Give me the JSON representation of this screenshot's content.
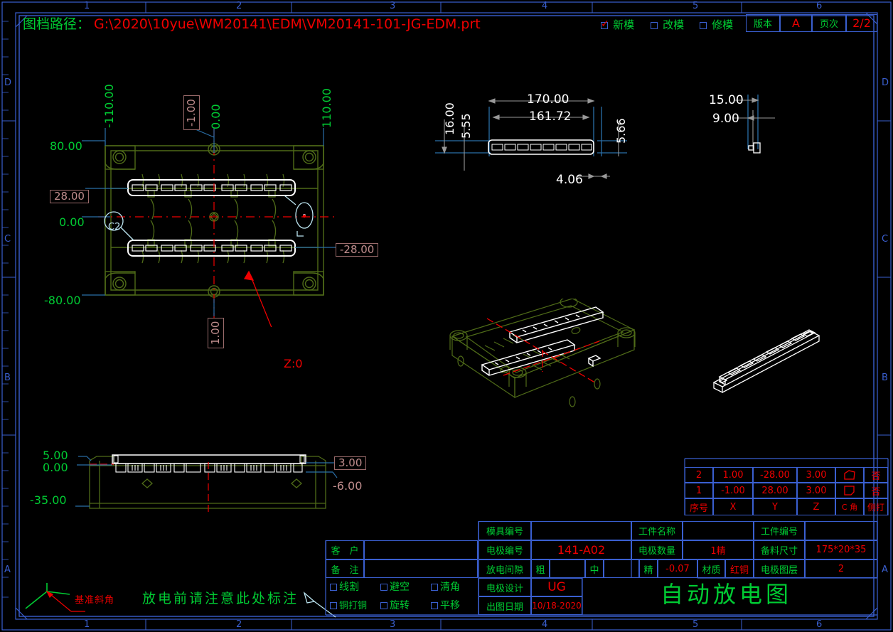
{
  "header": {
    "label": "图档路径：",
    "path": "G:\\2020\\10yue\\WM20141\\EDM\\VM20141-101-JG-EDM.prt",
    "checkboxes": [
      {
        "label": "新模",
        "checked": true
      },
      {
        "label": "改模",
        "checked": false
      },
      {
        "label": "修模",
        "checked": false
      }
    ],
    "version_label": "版本",
    "version_value": "A",
    "page_label": "页次",
    "page_value": "2/2"
  },
  "frame": {
    "cols": [
      "1",
      "2",
      "3",
      "4",
      "5",
      "6"
    ],
    "rows": [
      "D",
      "C",
      "B",
      "A"
    ]
  },
  "top_view": {
    "dims_left": [
      "80.00",
      "0.00",
      "-80.00"
    ],
    "dim_28": "28.00",
    "dim_neg28": "-28.00",
    "dim_neg110": "-110.00",
    "dim_110": "110.00",
    "dim_0_vert": "0.00",
    "dim_neg1": "-1.00",
    "dim_1": "1.00",
    "z_note": "Z:0",
    "bubble_left": "C2"
  },
  "detail_top": {
    "d170": "170.00",
    "d161": "161.72",
    "d16": "16.00",
    "d555": "5.55",
    "d566": "5.66",
    "d406": "4.06"
  },
  "detail_right": {
    "d15": "15.00",
    "d9": "9.00"
  },
  "front_view": {
    "d5": "5.00",
    "d0": "0.00",
    "d35": "-35.00",
    "d3": "3.00",
    "d6": "-6.00"
  },
  "notes": {
    "datum": "基准斜角",
    "warning": "放电前请注意此处标注"
  },
  "elec_table": {
    "headers": [
      "序号",
      "X",
      "Y",
      "Z",
      "C 角",
      "侧打"
    ],
    "rows": [
      {
        "no": "2",
        "x": "1.00",
        "y": "-28.00",
        "z": "3.00",
        "c": "shape-a",
        "side": "否"
      },
      {
        "no": "1",
        "x": "-1.00",
        "y": "28.00",
        "z": "3.00",
        "c": "shape-b",
        "side": "否"
      }
    ]
  },
  "title_block": {
    "customer_label": "客　户",
    "customer_value": "",
    "remark_label": "备　注",
    "remark_value": "",
    "mold_no_label": "模具编号",
    "mold_no_value": "",
    "elec_no_label": "电极编号",
    "elec_no_value": "141-A02",
    "part_name_label": "工件名称",
    "part_name_value": "",
    "part_no_label": "工件编号",
    "part_no_value": "",
    "elec_qty_label": "电极数量",
    "elec_qty_value": "1精",
    "stock_size_label": "备料尺寸",
    "stock_size_value": "175*20*35",
    "gap_label": "放电间隙",
    "gap_rough_label": "粗",
    "gap_rough_value": "",
    "gap_mid_label": "中",
    "gap_mid_value": "",
    "gap_fine_label": "精",
    "gap_fine_value": "-0.07",
    "material_label": "材质",
    "material_value": "红铜",
    "elec_layer_label": "电极图层",
    "elec_layer_value": "2",
    "elec_design_label": "电极设计",
    "elec_design_value": "UG",
    "issue_date_label": "出图日期",
    "issue_date_value": "10/18-2020",
    "main_title": "自动放电图",
    "options": [
      {
        "label": "线割",
        "checked": false
      },
      {
        "label": "避空",
        "checked": false
      },
      {
        "label": "清角",
        "checked": false
      },
      {
        "label": "铜打铜",
        "checked": false
      },
      {
        "label": "旋转",
        "checked": false
      },
      {
        "label": "平移",
        "checked": false
      }
    ]
  },
  "colors": {
    "green": "#00cc33",
    "red": "#ee0000",
    "blue": "#3a5fd0",
    "cyan": "#bde6f2",
    "white": "#ffffff",
    "tan": "#c08d8d",
    "olive": "#4f6b18"
  }
}
